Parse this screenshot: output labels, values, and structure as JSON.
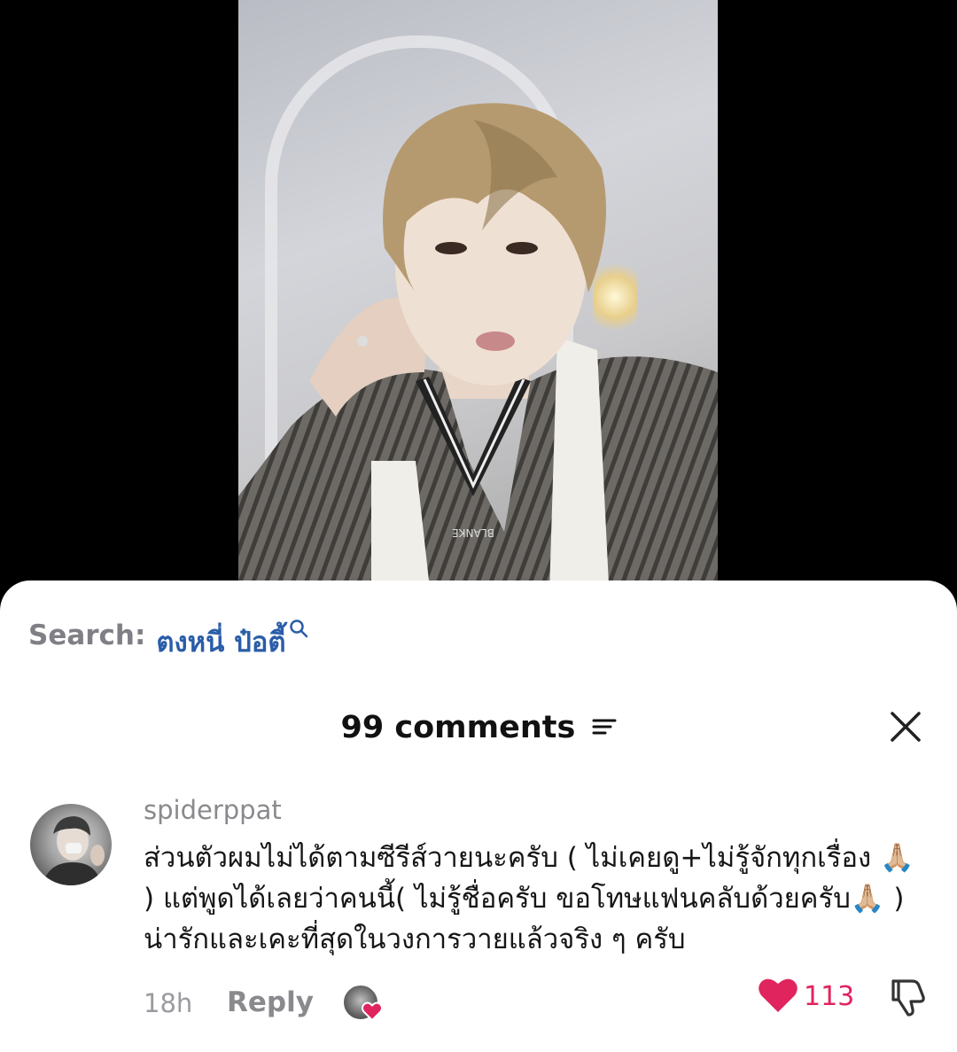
{
  "search": {
    "prefix": "Search:",
    "term": "ตงหนี่ ป๋อตี้"
  },
  "comments_header": {
    "count_label": "99 comments"
  },
  "comment": {
    "username": "spiderppat",
    "text": "ส่วนตัวผมไม่ได้ตามซีรีส์วายนะครับ ( ไม่เคยดู+ไม่รู้จักทุกเรื่อง 🙏🏼 ) แต่พูดได้เลยว่าคนนี้( ไม่รู้ชื่อครับ ขอโทษแฟนคลับด้วยครับ🙏🏼 ) น่ารักและเคะที่สุดในวงการวายแล้วจริง ๆ ครับ",
    "time": "18h",
    "reply_label": "Reply",
    "like_count": "113",
    "liked_by_creator": true
  },
  "colors": {
    "search_term": "#2a5da8",
    "like": "#e0245e",
    "muted_text": "#8a8a8e"
  },
  "icons": [
    "search-icon",
    "filter-icon",
    "close-icon",
    "heart-icon",
    "dislike-icon"
  ]
}
